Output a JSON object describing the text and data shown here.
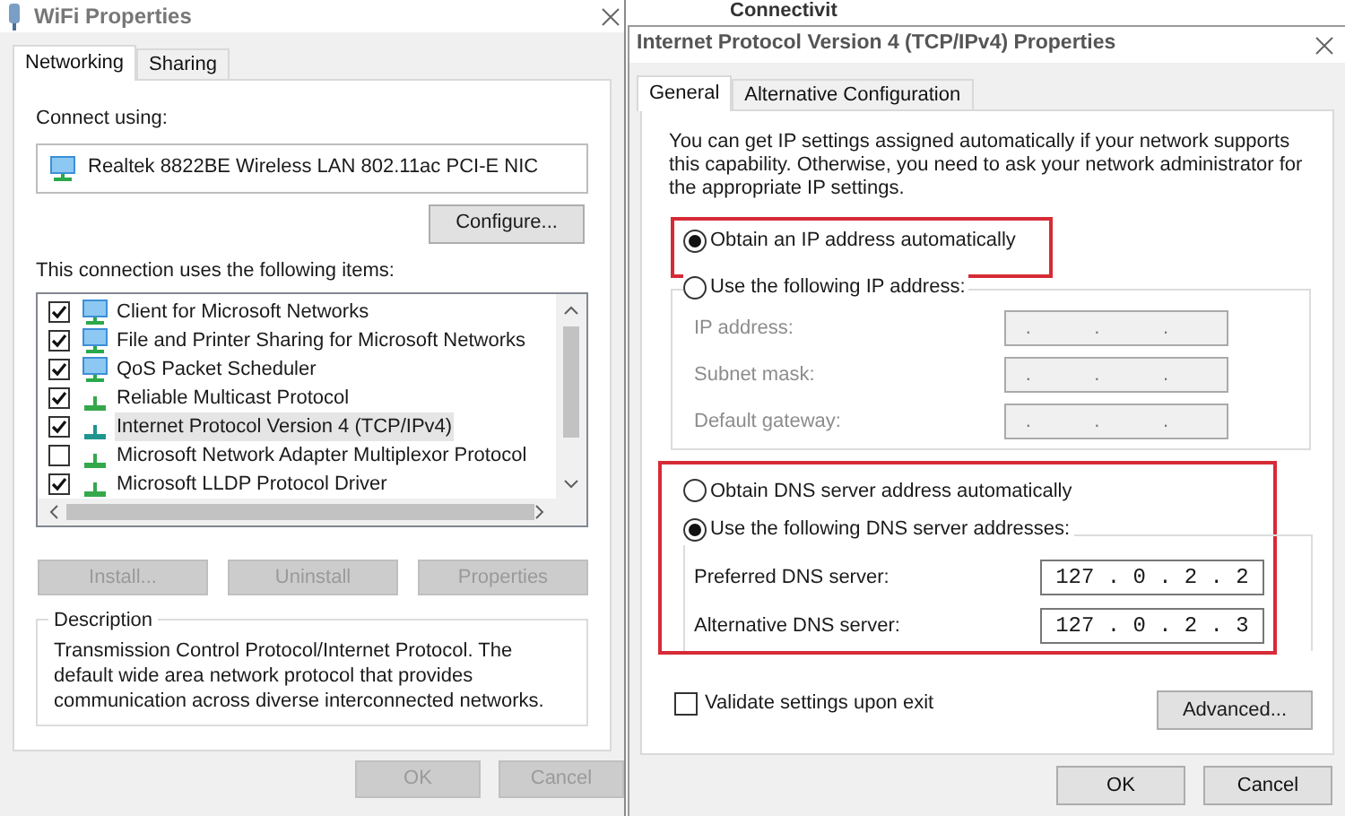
{
  "background_window": {
    "text": "Connectivit"
  },
  "wifi": {
    "title": "WiFi Properties",
    "tabs": [
      {
        "label": "Networking",
        "selected": true
      },
      {
        "label": "Sharing",
        "selected": false
      }
    ],
    "connect_using_label": "Connect using:",
    "adapter": "Realtek 8822BE Wireless LAN 802.11ac PCI-E NIC",
    "configure_button": "Configure...",
    "items_label": "This connection uses the following items:",
    "items": [
      {
        "label": "Client for Microsoft Networks",
        "checked": true,
        "kind": "client",
        "selected": false
      },
      {
        "label": "File and Printer Sharing for Microsoft Networks",
        "checked": true,
        "kind": "client",
        "selected": false
      },
      {
        "label": "QoS Packet Scheduler",
        "checked": true,
        "kind": "client",
        "selected": false
      },
      {
        "label": "Reliable Multicast Protocol",
        "checked": true,
        "kind": "protocol",
        "selected": false
      },
      {
        "label": "Internet Protocol Version 4 (TCP/IPv4)",
        "checked": true,
        "kind": "protocol",
        "selected": true
      },
      {
        "label": "Microsoft Network Adapter Multiplexor Protocol",
        "checked": false,
        "kind": "protocol",
        "selected": false
      },
      {
        "label": "Microsoft LLDP Protocol Driver",
        "checked": true,
        "kind": "protocol",
        "selected": false
      }
    ],
    "item_buttons": [
      {
        "label": "Install...",
        "disabled": true
      },
      {
        "label": "Uninstall",
        "disabled": true
      },
      {
        "label": "Properties",
        "disabled": true
      }
    ],
    "description": {
      "title": "Description",
      "text": "Transmission Control Protocol/Internet Protocol. The default wide area network protocol that provides communication across diverse interconnected networks."
    },
    "buttons": [
      {
        "label": "OK",
        "disabled": true
      },
      {
        "label": "Cancel",
        "disabled": true
      }
    ]
  },
  "ipv4": {
    "title": "Internet Protocol Version 4 (TCP/IPv4) Properties",
    "tabs": [
      {
        "label": "General",
        "selected": true
      },
      {
        "label": "Alternative Configuration",
        "selected": false
      }
    ],
    "intro": "You can get IP settings assigned automatically if your network supports this capability. Otherwise, you need to ask your network administrator for the appropriate IP settings.",
    "octet_separator": ".",
    "ip_options": [
      {
        "label": "Obtain an IP address automatically",
        "selected": true,
        "highlighted": true
      },
      {
        "label": "Use the following IP address:",
        "selected": false,
        "highlighted": false
      }
    ],
    "ip_fields": [
      {
        "label": "IP address:",
        "disabled": true
      },
      {
        "label": "Subnet mask:",
        "disabled": true
      },
      {
        "label": "Default gateway:",
        "disabled": true
      }
    ],
    "dns": {
      "highlighted": true,
      "options": [
        {
          "label": "Obtain DNS server address automatically",
          "selected": false
        },
        {
          "label": "Use the following DNS server addresses:",
          "selected": true
        }
      ],
      "fields": [
        {
          "label": "Preferred DNS server:",
          "disabled": false,
          "parts": [
            "127",
            "0",
            "2",
            "2"
          ]
        },
        {
          "label": "Alternative DNS server:",
          "disabled": false,
          "parts": [
            "127",
            "0",
            "2",
            "3"
          ]
        }
      ]
    },
    "validate": {
      "label": "Validate settings upon exit",
      "checked": false
    },
    "advanced_button": "Advanced...",
    "buttons": [
      {
        "label": "OK",
        "disabled": false
      },
      {
        "label": "Cancel",
        "disabled": false
      }
    ]
  }
}
